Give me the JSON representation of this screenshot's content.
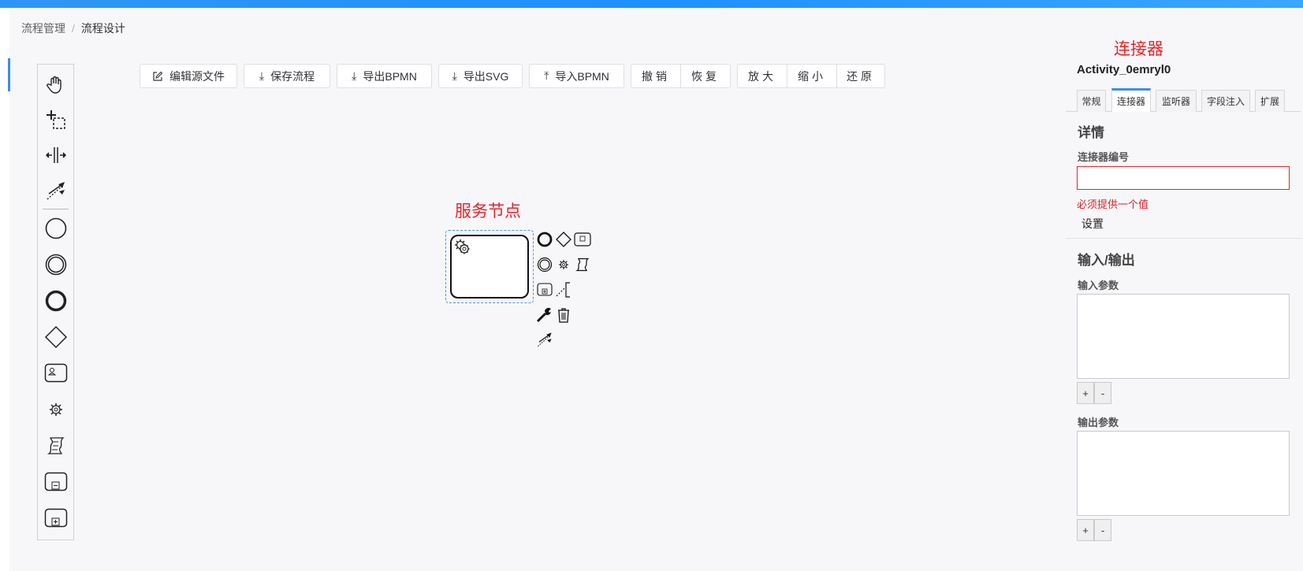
{
  "breadcrumb": {
    "parent": "流程管理",
    "separator": "/",
    "current": "流程设计"
  },
  "toolbar": {
    "edit_source": "编辑源文件",
    "save": "保存流程",
    "export_bpmn": "导出BPMN",
    "export_svg": "导出SVG",
    "import_bpmn": "导入BPMN",
    "undo": "撤销",
    "redo": "恢复",
    "zoom_in": "放大",
    "zoom_out": "缩小",
    "reset": "还原"
  },
  "palette": {
    "items": [
      "hand-tool",
      "lasso-tool",
      "space-tool",
      "global-connect-tool",
      "start-event",
      "intermediate-event",
      "end-event",
      "exclusive-gateway",
      "user-task",
      "service-task",
      "script-task",
      "collapsed-subprocess",
      "expanded-subprocess"
    ]
  },
  "canvas": {
    "annotation_service": "服务节点",
    "selected_element_type": "service-task"
  },
  "panel": {
    "annotation_connector": "连接器",
    "element_id": "Activity_0emryl0",
    "tabs": [
      "常规",
      "连接器",
      "监听器",
      "字段注入",
      "扩展"
    ],
    "active_tab": "连接器",
    "details_header": "详情",
    "connector_id_label": "连接器编号",
    "connector_id_value": "",
    "error_message": "必须提供一个值",
    "set_label": "设置",
    "io_header": "输入/输出",
    "input_params_label": "输入参数",
    "output_params_label": "输出参数",
    "add_label": "+",
    "remove_label": "-"
  },
  "colors": {
    "accent": "#3d8ee8",
    "error": "#e02a2a",
    "annotation": "#e8232a",
    "topbar": "#1e90ff"
  }
}
